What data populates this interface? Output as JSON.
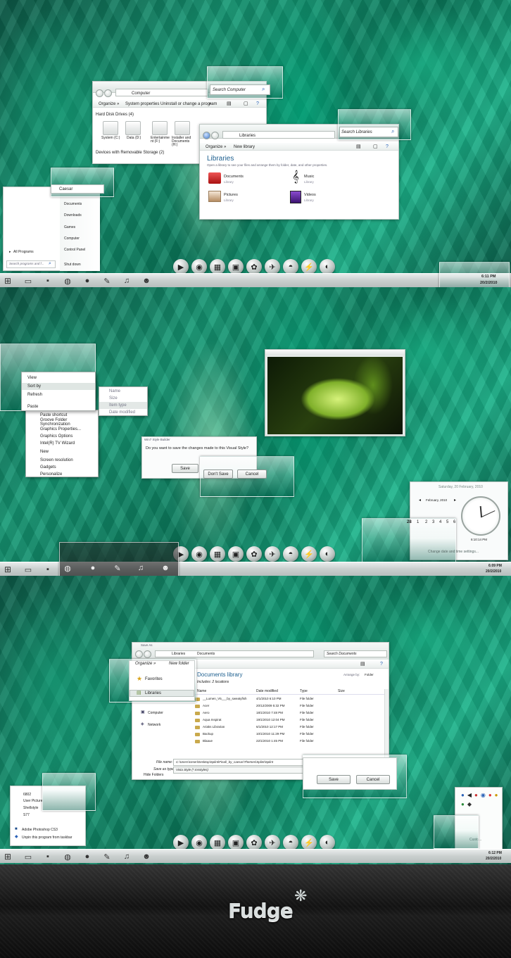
{
  "p1": {
    "computer": {
      "address": "Computer",
      "toolbar": [
        "Organize »",
        "System properties",
        "Uninstall or change a program",
        "»"
      ],
      "section_hdd": "Hard Disk Drives (4)",
      "drives": [
        "System (C:)",
        "Data (D:)",
        "Entertainme nt (F:)",
        "Installer and Documents (H:)"
      ],
      "section_removable": "Devices with Removable Storage (2)",
      "search": "Search Computer"
    },
    "libraries": {
      "address": "Libraries",
      "toolbar": [
        "Organize »",
        "New library"
      ],
      "title": "Libraries",
      "subtitle": "Open a library to see your files and arrange them by folder, date, and other properties.",
      "items": [
        {
          "name": "Documents",
          "sub": "Library"
        },
        {
          "name": "Music",
          "sub": "Library"
        },
        {
          "name": "Pictures",
          "sub": "Library"
        },
        {
          "name": "Videos",
          "sub": "Library"
        }
      ],
      "search": "Search Libraries"
    },
    "start": {
      "user": "Caesar",
      "right_items": [
        "Documents",
        "Downloads",
        "Games",
        "Computer",
        "Control Panel"
      ],
      "all_programs": "All Programs",
      "search_placeholder": "Search programs and f...",
      "shutdown": "Shut down"
    },
    "clock": {
      "time": "6:11 PM",
      "date": "20/2/2010"
    }
  },
  "p2": {
    "context": {
      "items": [
        "View",
        "Sort by",
        "Refresh",
        "Paste",
        "Paste shortcut",
        "Groove Folder Synchronization",
        "Graphics Properties...",
        "Graphics Options",
        "Intel(R) TV Wizard",
        "New",
        "Screen resolution",
        "Gadgets",
        "Personalize"
      ],
      "submenu": [
        "Name",
        "Size",
        "Item type",
        "Date modified"
      ]
    },
    "dialog": {
      "title": "Win7 Style Builder",
      "question": "Do you want to save the changes made to this Visual Style?",
      "save": "Save",
      "dont_save": "Don't Save",
      "cancel": "Cancel"
    },
    "calendar": {
      "header": "Saturday, 20 February, 2010",
      "month": "February, 2010",
      "row": [
        "28",
        "1",
        "2",
        "3",
        "4",
        "5",
        "6"
      ],
      "time": "6:10:14 PM",
      "change": "Change date and time settings..."
    },
    "clock": {
      "time": "6:09 PM",
      "date": "20/2/2010"
    }
  },
  "p3": {
    "save": {
      "title": "Save As",
      "address": [
        "Libraries",
        "Documents"
      ],
      "search": "Search Documents",
      "toolbar": [
        "Organize »",
        "New folder"
      ],
      "nav": [
        "Favorites",
        "Libraries",
        "Computer",
        "Network"
      ],
      "lib_title": "Documents library",
      "lib_sub": "Includes: 2 locations",
      "arrange_label": "Arrange by:",
      "arrange_value": "Folder",
      "columns": [
        "Name",
        "Date modified",
        "Type",
        "Size"
      ],
      "rows": [
        {
          "name": "__Lumen_V5___by_sweatyfish",
          "date": "4/1/2010 6:10 PM",
          "type": "File folder"
        },
        {
          "name": "Acer",
          "date": "20/12/2009 5:32 PM",
          "type": "File folder"
        },
        {
          "name": "Aero",
          "date": "18/1/2010 7:48 PM",
          "type": "File folder"
        },
        {
          "name": "Aqua Inspirat",
          "date": "19/1/2010 12:04 PM",
          "type": "File folder"
        },
        {
          "name": "Ariaks Librarian",
          "date": "6/1/2010 12:17 PM",
          "type": "File folder"
        },
        {
          "name": "Backup",
          "date": "10/1/2010 11:29 PM",
          "type": "File folder"
        },
        {
          "name": "Blaaue",
          "date": "22/1/2010 1:45 PM",
          "type": "File folder"
        }
      ],
      "filename_label": "File name:",
      "filename": "C:\\Users\\ceser\\Desktop\\Splint\\Final\\_by_caesar\\Themes\\Splint\\Splint",
      "type_label": "Save as type:",
      "type_value": "Vista Style (*.msstyles)",
      "hide": "Hide Folders",
      "save_btn": "Save",
      "cancel_btn": "Cancel"
    },
    "jumplist": {
      "items": [
        "6802",
        "User Picture",
        "Shellstyle",
        "S77"
      ],
      "app": "Adobe Photoshop CS3",
      "unpin": "Unpin this program from taskbar"
    },
    "tray": {
      "custom": "Custo..."
    },
    "clock": {
      "time": "6:12 PM",
      "date": "20/2/2010"
    }
  },
  "brand": {
    "name": "Fudge"
  },
  "colors": {
    "accent": "#1aa37e",
    "taskbar": "#c9cfce",
    "brand_bg": "#141414"
  }
}
